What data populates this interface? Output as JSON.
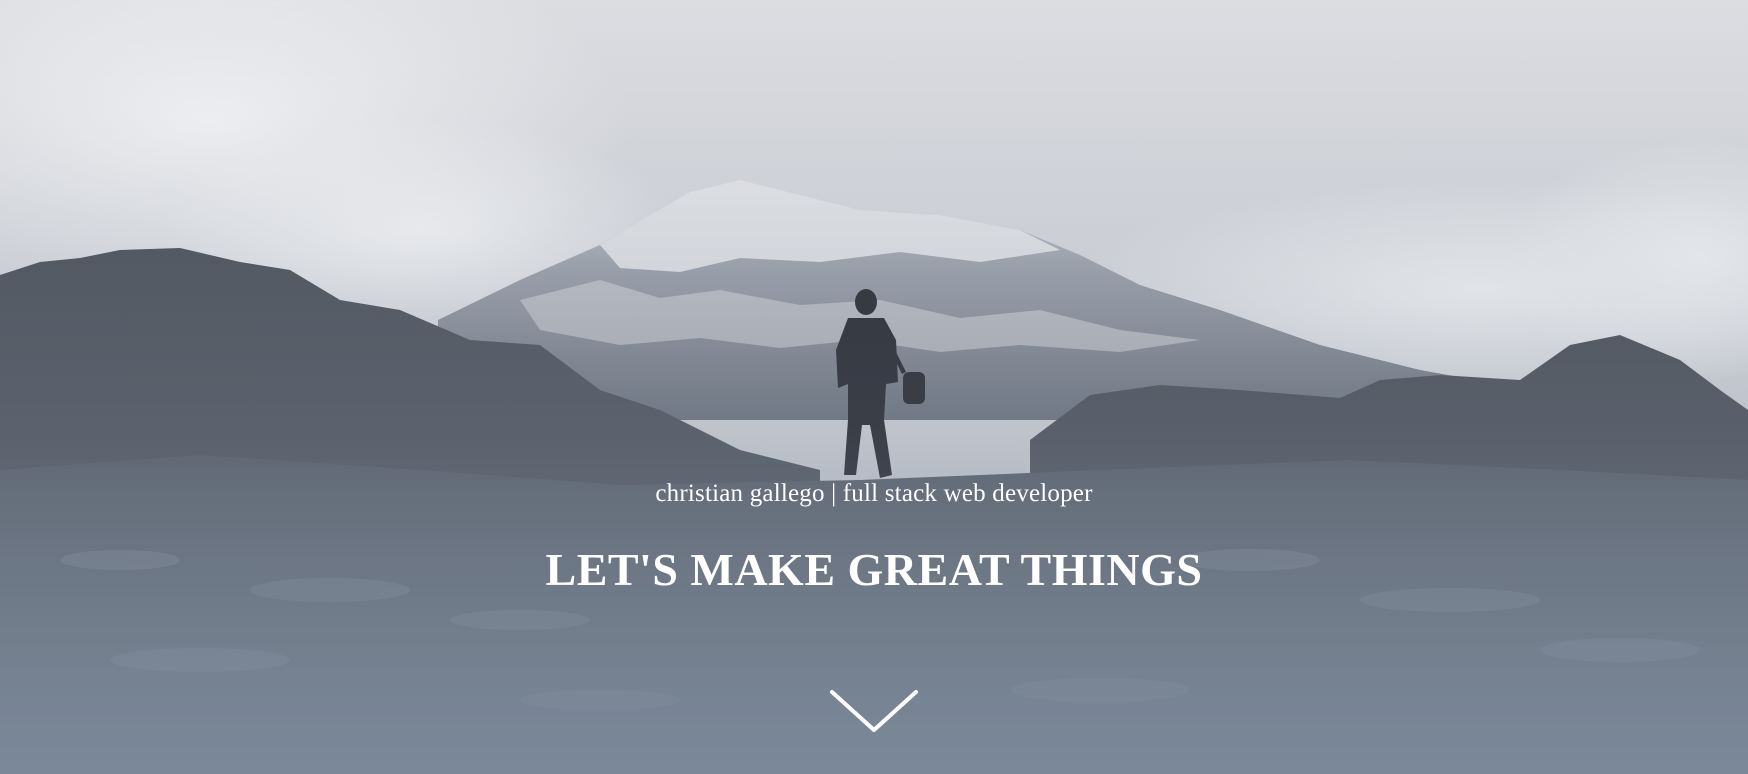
{
  "hero": {
    "tagline": "christian gallego | full stack web developer",
    "headline": "LET'S MAKE GREAT THINGS",
    "scroll_icon": "chevron-down-icon"
  },
  "colors": {
    "sky": "#d9dbe0",
    "overlay_bottom": "#7a8899",
    "rock_dark": "#4a4f58",
    "snow": "#e6e7ea",
    "text": "#ffffff"
  }
}
